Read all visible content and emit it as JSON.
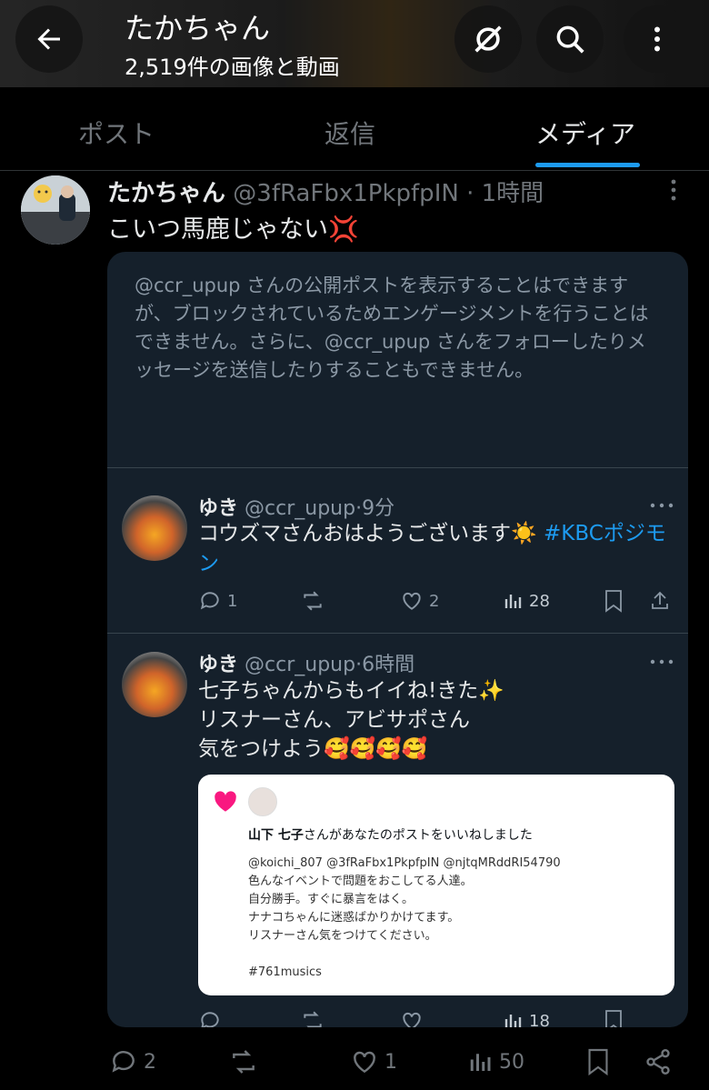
{
  "header": {
    "title": "たかちゃん",
    "subtitle": "2,519件の画像と動画"
  },
  "tabs": [
    {
      "label": "ポスト",
      "active": false
    },
    {
      "label": "返信",
      "active": false
    },
    {
      "label": "メディア",
      "active": true
    }
  ],
  "post": {
    "author_name": "たかちゃん",
    "author_handle": "@3fRaFbx1PkpfpIN",
    "time": "1時間",
    "text": "こいつ馬鹿じゃない",
    "emoji": "💢"
  },
  "embed": {
    "notice": "@ccr_upup さんの公開ポストを表示することはできますが、ブロックされているためエンゲージメントを行うことはできません。さらに、@ccr_upup さんをフォローしたりメッセージを送信したりすることもできません。",
    "replies": [
      {
        "name": "ゆき",
        "handle": "@ccr_upup",
        "time": "9分",
        "text": "コウズマさんおはようございます☀️ ",
        "hashtag": "#KBCポジモン",
        "replies": "1",
        "likes": "2",
        "views": "28"
      },
      {
        "name": "ゆき",
        "handle": "@ccr_upup",
        "time": "6時間",
        "line1": "七子ちゃんからもイイね!きた✨",
        "line2": "リスナーさん、アビサポさん",
        "line3": "気をつけよう🥰🥰🥰🥰",
        "views": "18"
      }
    ],
    "notification": {
      "title_prefix": "山下 七子",
      "title_suffix": "さんがあなたのポストをいいねしました",
      "mentions": "@koichi_807 @3fRaFbx1PkpfpIN @njtqMRddRI54790",
      "line1": "色んなイベントで問題をおこしてる人達。",
      "line2": "自分勝手。すぐに暴言をはく。",
      "line3": "ナナコちゃんに迷惑ばかりかけてます。",
      "line4": "リスナーさん気をつけてください。",
      "hashtag": "#761musics"
    }
  },
  "bottom_actions": {
    "replies": "2",
    "likes": "1",
    "views": "50"
  },
  "colors": {
    "accent": "#1d9bf0",
    "background": "#000000",
    "embed_bg": "#15202b",
    "heart": "#f91880"
  }
}
